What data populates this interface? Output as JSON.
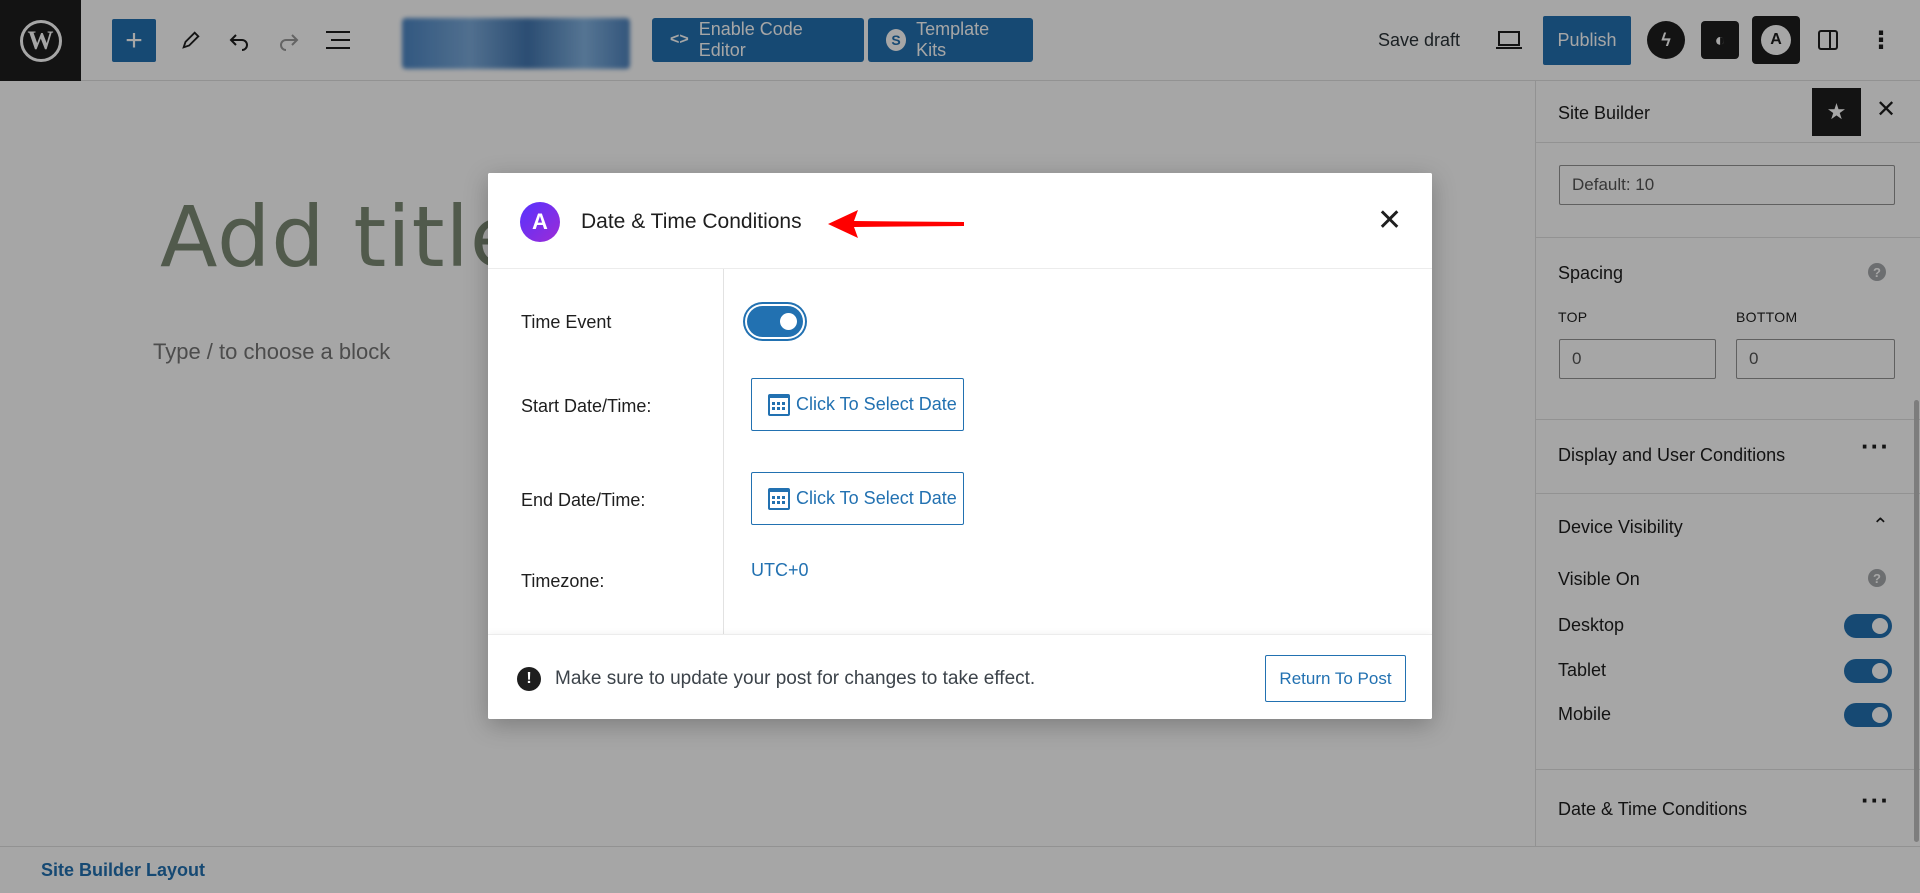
{
  "toolbar": {
    "add_icon": "plus-icon",
    "enable_code_editor": "Enable Code Editor",
    "template_kits": "Template Kits",
    "save_draft": "Save draft",
    "publish": "Publish"
  },
  "editor": {
    "title_placeholder": "Add title",
    "block_hint": "Type / to choose a block"
  },
  "sidebar": {
    "title": "Site Builder",
    "default_value": "Default: 10",
    "spacing_label": "Spacing",
    "top_label": "TOP",
    "bottom_label": "BOTTOM",
    "top_value": "0",
    "bottom_value": "0",
    "display_user_conditions": "Display and User Conditions",
    "device_visibility": "Device Visibility",
    "visible_on": "Visible On",
    "devices": [
      {
        "label": "Desktop",
        "enabled": true
      },
      {
        "label": "Tablet",
        "enabled": true
      },
      {
        "label": "Mobile",
        "enabled": true
      }
    ],
    "date_time_conditions": "Date & Time Conditions"
  },
  "footer": {
    "link": "Site Builder Layout"
  },
  "modal": {
    "title": "Date & Time Conditions",
    "time_event_label": "Time Event",
    "time_event_enabled": true,
    "start_label": "Start Date/Time:",
    "start_button": "Click To Select Date",
    "end_label": "End Date/Time:",
    "end_button": "Click To Select Date",
    "timezone_label": "Timezone:",
    "timezone_value": "UTC+0",
    "note": "Make sure to update your post for changes to take effect.",
    "return_button": "Return To Post"
  },
  "colors": {
    "accent": "#2271b1",
    "arrow": "#ff0000",
    "brand_gradient_start": "#5733ff",
    "brand_gradient_end": "#9c2bd6"
  }
}
